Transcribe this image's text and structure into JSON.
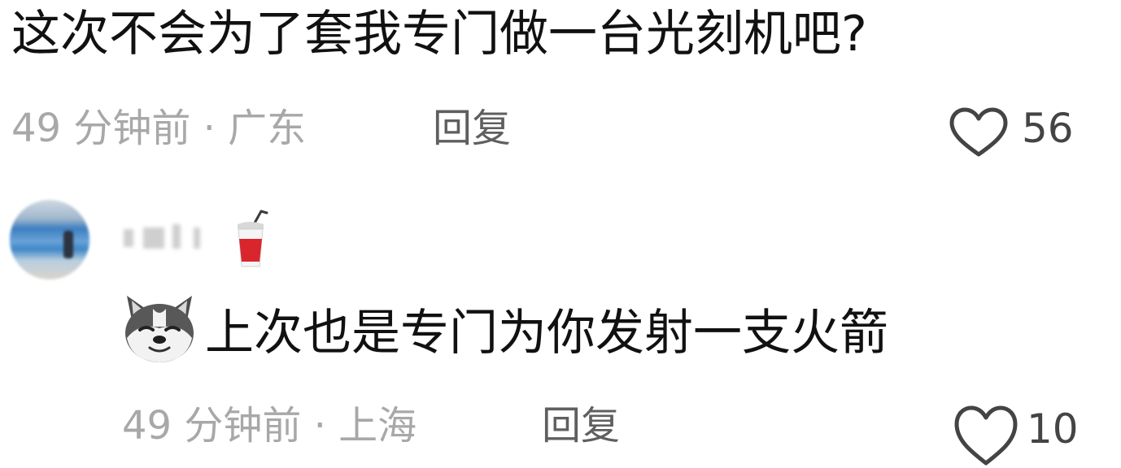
{
  "comment1": {
    "text": "这次不会为了套我专门做一台光刻机吧?",
    "meta": "49 分钟前 · 广东",
    "reply_label": "回复",
    "like_count": "56"
  },
  "comment2": {
    "username": "",
    "text": "上次也是专门为你发射一支火箭",
    "meta": "49 分钟前 · 上海",
    "reply_label": "回复",
    "like_count": "10"
  },
  "icons": {
    "like": "heart-outline-icon",
    "badge": "drink-cup-icon",
    "inline_emoji": "husky-dog-emoji"
  },
  "colors": {
    "text": "#111111",
    "meta": "#a8a8a8",
    "reply": "#5f5f5f",
    "icon": "#444444"
  }
}
